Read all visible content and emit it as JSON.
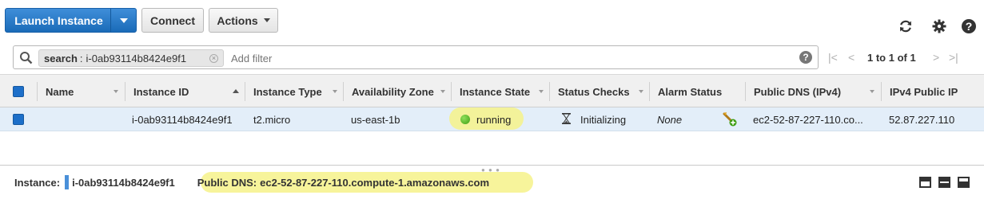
{
  "toolbar": {
    "launch_label": "Launch Instance",
    "connect_label": "Connect",
    "actions_label": "Actions"
  },
  "icons": {
    "refresh": "refresh-icon",
    "settings": "gear-icon",
    "help": "help-icon",
    "search": "search-icon"
  },
  "filter": {
    "token_key": "search",
    "token_separator": ":",
    "token_value": "i-0ab93114b8424e9f1",
    "placeholder": "Add filter",
    "help_glyph": "?"
  },
  "pagination": {
    "text": "1 to 1 of 1",
    "first": "|<",
    "prev": "<",
    "next": ">",
    "last": ">|"
  },
  "table": {
    "columns": [
      "Name",
      "Instance ID",
      "Instance Type",
      "Availability Zone",
      "Instance State",
      "Status Checks",
      "Alarm Status",
      "Public DNS (IPv4)",
      "IPv4 Public IP"
    ],
    "rows": [
      {
        "name": "",
        "instance_id": "i-0ab93114b8424e9f1",
        "instance_type": "t2.micro",
        "availability_zone": "us-east-1b",
        "instance_state": "running",
        "status_checks": "Initializing",
        "alarm_status": "None",
        "public_dns": "ec2-52-87-227-110.co...",
        "public_ip": "52.87.227.110"
      }
    ]
  },
  "details": {
    "instance_label": "Instance:",
    "instance_id": "i-0ab93114b8424e9f1",
    "public_dns_label": "Public DNS:",
    "public_dns": "ec2-52-87-227-110.compute-1.amazonaws.com"
  },
  "colors": {
    "primary": "#1a6bb8",
    "running": "#3f9e14",
    "highlight": "#f6f28a",
    "row_selected": "#e3eef9"
  }
}
